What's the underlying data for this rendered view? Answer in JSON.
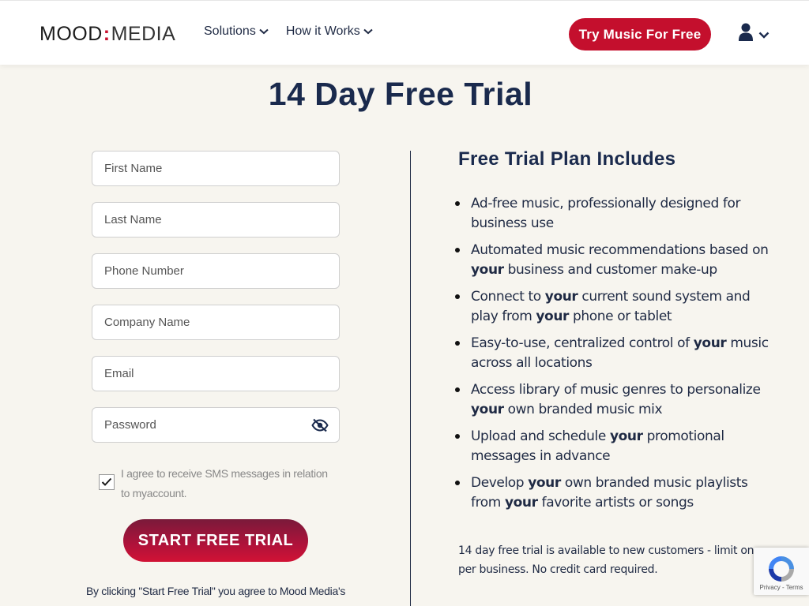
{
  "header": {
    "logo": {
      "part1": "MOOD",
      "separator": ":",
      "part2": "MEDIA"
    },
    "nav": [
      {
        "label": "Solutions"
      },
      {
        "label": "How it Works"
      }
    ],
    "cta_label": "Try Music For Free",
    "account_icon": "user-icon"
  },
  "page": {
    "title": "14 Day Free Trial"
  },
  "form": {
    "first_name_placeholder": "First Name",
    "last_name_placeholder": "Last Name",
    "phone_placeholder": "Phone Number",
    "company_placeholder": "Company Name",
    "email_placeholder": "Email",
    "password_placeholder": "Password",
    "sms_consent_label": "I agree to receive SMS messages in relation to myaccount.",
    "sms_consent_checked": true,
    "submit_label": "START FREE TRIAL",
    "legal_text": "By clicking \"Start Free Trial\" you agree to Mood Media's"
  },
  "plan": {
    "title": "Free Trial Plan Includes",
    "items": [
      [
        "Ad-free music, professionally designed for business use"
      ],
      [
        "Automated music recommendations based on ",
        "your",
        " business and customer make-up"
      ],
      [
        "Connect to ",
        "your",
        " current sound system and play from ",
        "your",
        " phone or tablet"
      ],
      [
        "Easy-to-use, centralized control of ",
        "your",
        " music across all locations"
      ],
      [
        "Access library of music genres to personalize ",
        "your",
        " own branded music mix"
      ],
      [
        "Upload and schedule ",
        "your",
        " promotional messages in advance"
      ],
      [
        "Develop ",
        "your",
        " own branded music playlists from ",
        "your",
        " favorite artists or songs"
      ]
    ],
    "note": "14 day free trial is available to new customers - limit one per business. No credit card required."
  },
  "recaptcha": {
    "links": "Privacy - Terms"
  },
  "colors": {
    "brand_red": "#c40f2d",
    "navy": "#1a2a4d",
    "background": "#f7f5ef"
  }
}
